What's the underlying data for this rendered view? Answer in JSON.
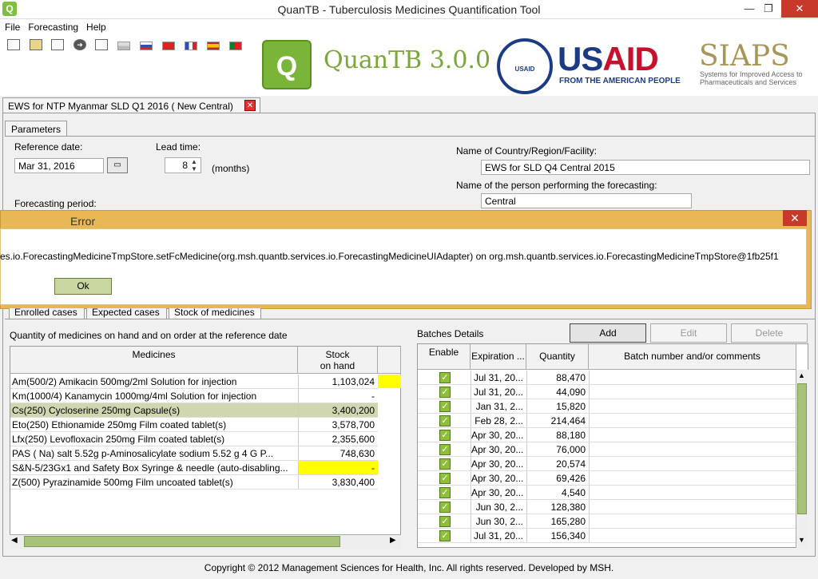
{
  "window": {
    "title": "QuanTB - Tuberculosis Medicines Quantification Tool",
    "app_icon": "quantb-icon",
    "minimize_glyph": "—",
    "maximize_glyph": "❐",
    "close_glyph": "✕"
  },
  "menu": {
    "items": [
      "File",
      "Forecasting",
      "Help"
    ]
  },
  "branding": {
    "product": "QuanTB 3.0.0",
    "logo_glyph": "Q",
    "seal_text": "USAID",
    "usaid_us": "US",
    "usaid_aid": "AID",
    "usaid_sub": "FROM THE AMERICAN PEOPLE",
    "siaps": "SIAPS",
    "siaps_sub": "Systems for Improved Access to Pharmaceuticals and Services"
  },
  "document_tab": {
    "label": "EWS for NTP Myanmar  SLD Q1 2016  ( New Central)",
    "close_glyph": "✕"
  },
  "parameters": {
    "tab_label": "Parameters",
    "reference_date_label": "Reference date:",
    "reference_date_value": "Mar 31, 2016",
    "lead_time_label": "Lead time:",
    "lead_time_value": "8",
    "lead_time_unit": "(months)",
    "forecasting_period_label": "Forecasting period:",
    "country_label": "Name of Country/Region/Facility:",
    "country_value": "EWS for SLD Q4 Central 2015",
    "person_label": "Name of the person performing the forecasting:",
    "person_value": "Central"
  },
  "error_dialog": {
    "title": "Error",
    "message": "es.io.ForecastingMedicineTmpStore.setFcMedicine(org.msh.quantb.services.io.ForecastingMedicineUIAdapter) on org.msh.quantb.services.io.ForecastingMedicineTmpStore@1fb25f1",
    "ok_label": "Ok",
    "close_glyph": "✕"
  },
  "sub_tabs": [
    "Enrolled cases",
    "Expected cases",
    "Stock of medicines"
  ],
  "stock": {
    "section_label": "Quantity of medicines on hand and on order at the reference date",
    "col_medicines": "Medicines",
    "col_stock_line1": "Stock",
    "col_stock_line2": "on hand",
    "rows": [
      {
        "name": "Am(500/2)  Amikacin  500mg/2ml  Solution for injection",
        "stock": "1,103,024",
        "flag": "yellow"
      },
      {
        "name": "Km(1000/4)  Kanamycin  1000mg/4ml  Solution for injection",
        "stock": "-",
        "flag": ""
      },
      {
        "name": "Cs(250)  Cycloserine  250mg  Capsule(s)",
        "stock": "3,400,200",
        "flag": "selected"
      },
      {
        "name": "Eto(250)  Ethionamide  250mg  Film coated tablet(s)",
        "stock": "3,578,700",
        "flag": ""
      },
      {
        "name": "Lfx(250)  Levofloxacin  250mg  Film coated tablet(s)",
        "stock": "2,355,600",
        "flag": ""
      },
      {
        "name": "PAS ( Na) salt 5.52g   p-Aminosalicylate sodium 5.52 g   4 G P...",
        "stock": "748,630",
        "flag": ""
      },
      {
        "name": "S&N-5/23Gx1 and Safety Box   Syringe & needle (auto-disabling...",
        "stock": "-",
        "flag": "yellow-cell"
      },
      {
        "name": "Z(500)  Pyrazinamide  500mg  Film uncoated tablet(s)",
        "stock": "3,830,400",
        "flag": ""
      }
    ]
  },
  "batches": {
    "section_label": "Batches Details",
    "add_label": "Add",
    "edit_label": "Edit",
    "delete_label": "Delete",
    "col_enable": "Enable",
    "col_expiration": "Expiration ...",
    "col_quantity": "Quantity",
    "col_comments": "Batch number and/or comments",
    "check_glyph": "✓",
    "rows": [
      {
        "expiration": "Jul 31, 20...",
        "quantity": "88,470"
      },
      {
        "expiration": "Jul 31, 20...",
        "quantity": "44,090"
      },
      {
        "expiration": "Jan 31, 2...",
        "quantity": "15,820"
      },
      {
        "expiration": "Feb 28, 2...",
        "quantity": "214,464"
      },
      {
        "expiration": "Apr 30, 20...",
        "quantity": "88,180"
      },
      {
        "expiration": "Apr 30, 20...",
        "quantity": "76,000"
      },
      {
        "expiration": "Apr 30, 20...",
        "quantity": "20,574"
      },
      {
        "expiration": "Apr 30, 20...",
        "quantity": "69,426"
      },
      {
        "expiration": "Apr 30, 20...",
        "quantity": "4,540"
      },
      {
        "expiration": "Jun 30, 2...",
        "quantity": "128,380"
      },
      {
        "expiration": "Jun 30, 2...",
        "quantity": "165,280"
      },
      {
        "expiration": "Jul 31, 20...",
        "quantity": "156,340"
      }
    ]
  },
  "footer": "Copyright © 2012 Management Sciences for Health, Inc. All rights reserved. Developed by MSH."
}
